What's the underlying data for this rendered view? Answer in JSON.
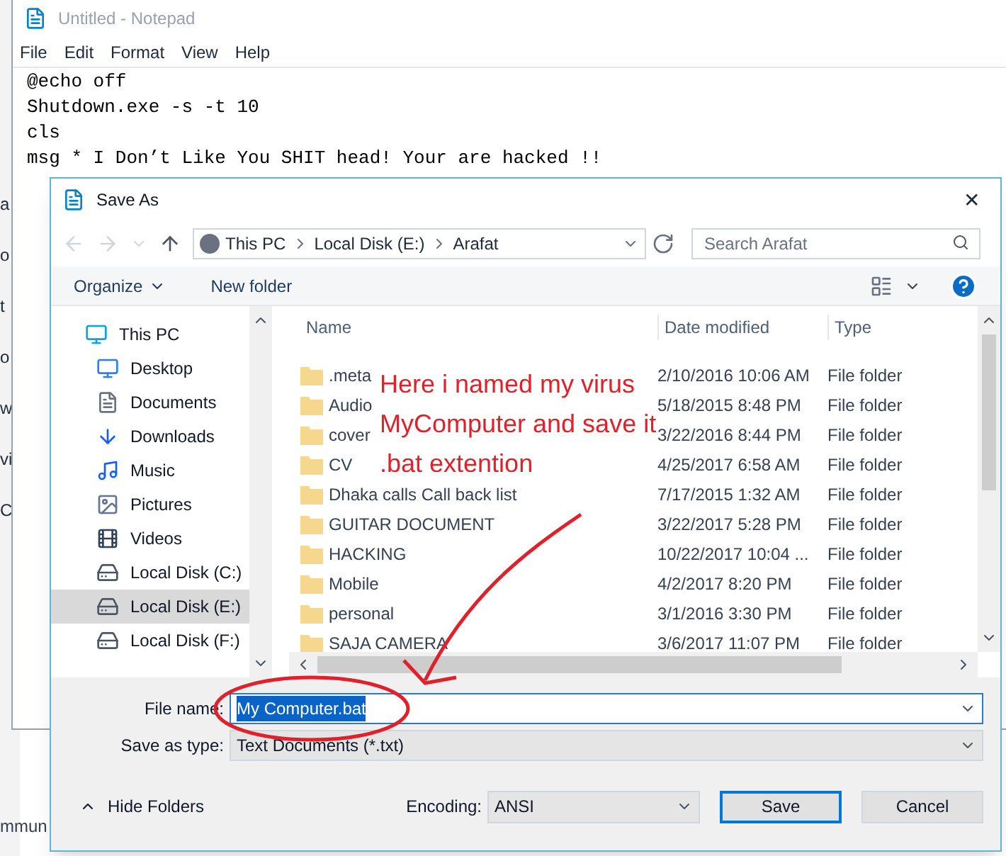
{
  "background_window": {
    "fragments": [
      "a",
      "o",
      "t",
      "o",
      "w",
      "vi",
      "C",
      "mmun"
    ]
  },
  "notepad": {
    "title": "Untitled - Notepad",
    "menu": [
      "File",
      "Edit",
      "Format",
      "View",
      "Help"
    ],
    "lines": [
      "@echo off",
      "Shutdown.exe -s -t 10",
      "cls",
      "msg * I Don’t Like You SHIT head! Your are hacked !!"
    ]
  },
  "dialog": {
    "title": "Save As",
    "close": "✕",
    "address": {
      "crumbs": [
        "This PC",
        "Local Disk (E:)",
        "Arafat"
      ]
    },
    "search": {
      "placeholder": "Search Arafat"
    },
    "toolbar": {
      "organize": "Organize",
      "new_folder": "New folder"
    },
    "sidebar": {
      "items": [
        {
          "label": "This PC",
          "kind": "pc",
          "selected": false,
          "children": [
            {
              "label": "Desktop",
              "kind": "desktop",
              "selected": false
            },
            {
              "label": "Documents",
              "kind": "documents",
              "selected": false
            },
            {
              "label": "Downloads",
              "kind": "downloads",
              "selected": false
            },
            {
              "label": "Music",
              "kind": "music",
              "selected": false
            },
            {
              "label": "Pictures",
              "kind": "pictures",
              "selected": false
            },
            {
              "label": "Videos",
              "kind": "videos",
              "selected": false
            },
            {
              "label": "Local Disk (C:)",
              "kind": "disk",
              "selected": false
            },
            {
              "label": "Local Disk (E:)",
              "kind": "disk",
              "selected": true
            },
            {
              "label": "Local Disk (F:)",
              "kind": "disk",
              "selected": false
            }
          ]
        }
      ]
    },
    "table": {
      "columns": [
        "Name",
        "Date modified",
        "Type"
      ],
      "rows": [
        {
          "name": ".meta",
          "date": "2/10/2016 10:06 AM",
          "type": "File folder"
        },
        {
          "name": "Audio",
          "date": "5/18/2015 8:48 PM",
          "type": "File folder"
        },
        {
          "name": "cover",
          "date": "3/22/2016 8:44 PM",
          "type": "File folder"
        },
        {
          "name": "CV",
          "date": "4/25/2017 6:58 AM",
          "type": "File folder"
        },
        {
          "name": "Dhaka calls Call back list",
          "date": "7/17/2015 1:32 AM",
          "type": "File folder"
        },
        {
          "name": "GUITAR DOCUMENT",
          "date": "3/22/2017 5:28 PM",
          "type": "File folder"
        },
        {
          "name": "HACKING",
          "date": "10/22/2017 10:04 ...",
          "type": "File folder"
        },
        {
          "name": "Mobile",
          "date": "4/2/2017 8:20 PM",
          "type": "File folder"
        },
        {
          "name": "personal",
          "date": "3/1/2016 3:30 PM",
          "type": "File folder"
        },
        {
          "name": "SAJA CAMERA",
          "date": "3/6/2017 11:07 PM",
          "type": "File folder"
        }
      ]
    },
    "file_name": {
      "label": "File name:",
      "value": "My Computer.bat"
    },
    "save_as_type": {
      "label": "Save as type:",
      "value": "Text Documents (*.txt)"
    },
    "hide_folders": "Hide Folders",
    "encoding": {
      "label": "Encoding:",
      "value": "ANSI"
    },
    "buttons": [
      "Save",
      "Cancel"
    ]
  },
  "annotation": {
    "lines": [
      "Here i named my virus",
      "MyComputer and save it",
      ".bat extention"
    ]
  }
}
